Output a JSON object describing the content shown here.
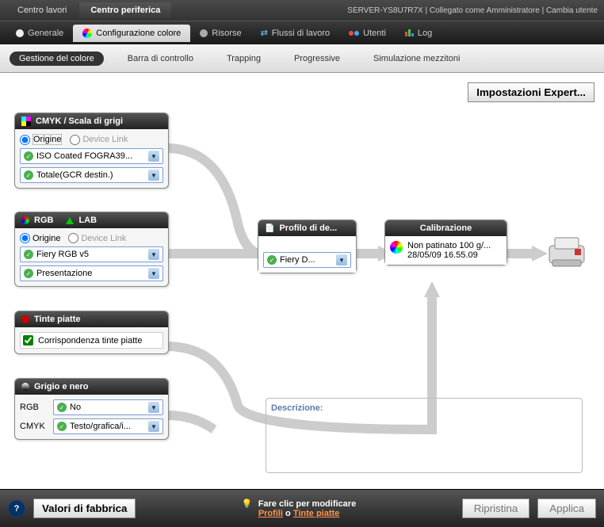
{
  "top": {
    "tab1": "Centro lavori",
    "tab2": "Centro periferica",
    "server": "SERVER-YS8U7R7X | Collegato come Amministratore | Cambia utente"
  },
  "mainTabs": {
    "generale": "Generale",
    "config": "Configurazione colore",
    "risorse": "Risorse",
    "flussi": "Flussi di lavoro",
    "utenti": "Utenti",
    "log": "Log"
  },
  "subTabs": {
    "gestione": "Gestione del colore",
    "barra": "Barra di controllo",
    "trapping": "Trapping",
    "progressive": "Progressive",
    "simulazione": "Simulazione mezzitoni"
  },
  "expertBtn": "Impostazioni Expert...",
  "cmyk": {
    "title": "CMYK / Scala di grigi",
    "origine": "Origine",
    "devicelink": "Device Link",
    "sel1": "ISO Coated FOGRA39...",
    "sel2": "Totale(GCR destin.)"
  },
  "rgblab": {
    "rgb": "RGB",
    "lab": "LAB",
    "origine": "Origine",
    "devicelink": "Device Link",
    "sel1": "Fiery RGB v5",
    "sel2": "Presentazione"
  },
  "tinte": {
    "title": "Tinte piatte",
    "check": "Corrispondenza tinte piatte"
  },
  "grigio": {
    "title": "Grigio e nero",
    "rgbLabel": "RGB",
    "rgbVal": "No",
    "cmykLabel": "CMYK",
    "cmykVal": "Testo/grafica/i..."
  },
  "profilo": {
    "title": "Profilo di de...",
    "val": "Fiery D..."
  },
  "calib": {
    "title": "Calibrazione",
    "line1": "Non patinato 100 g/...",
    "line2": "28/05/09 16.55.09"
  },
  "desc": {
    "label": "Descrizione:"
  },
  "bottom": {
    "factory": "Valori di fabbrica",
    "hint": "Fare clic per modificare",
    "link1": "Profili",
    "or": " o ",
    "link2": "Tinte piatte",
    "ripristina": "Ripristina",
    "applica": "Applica"
  }
}
